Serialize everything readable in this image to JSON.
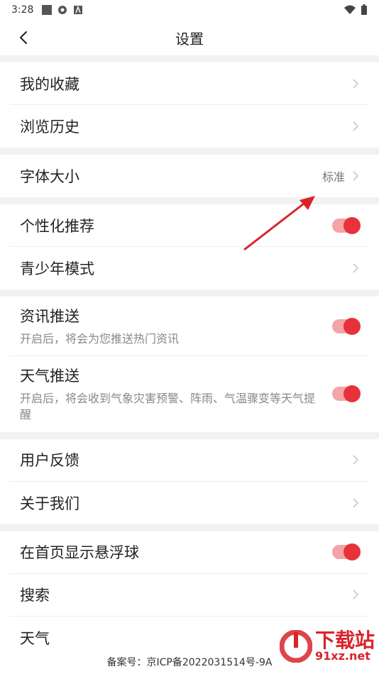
{
  "status": {
    "time": "3:28"
  },
  "header": {
    "title": "设置"
  },
  "groups": [
    [
      {
        "label": "我的收藏",
        "kind": "chevron"
      },
      {
        "label": "浏览历史",
        "kind": "chevron"
      }
    ],
    [
      {
        "label": "字体大小",
        "kind": "chevron",
        "value": "标准"
      }
    ],
    [
      {
        "label": "个性化推荐",
        "kind": "toggle",
        "on": true
      },
      {
        "label": "青少年模式",
        "kind": "chevron"
      }
    ],
    [
      {
        "label": "资讯推送",
        "kind": "toggle",
        "on": true,
        "sub": "开启后，将会为您推送热门资讯"
      },
      {
        "label": "天气推送",
        "kind": "toggle",
        "on": true,
        "sub": "开启后，将会收到气象灾害预警、阵雨、气温骤变等天气提醒"
      }
    ],
    [
      {
        "label": "用户反馈",
        "kind": "chevron"
      },
      {
        "label": "关于我们",
        "kind": "chevron"
      }
    ],
    [
      {
        "label": "在首页显示悬浮球",
        "kind": "toggle",
        "on": true
      },
      {
        "label": "搜索",
        "kind": "chevron"
      },
      {
        "label": "天气",
        "kind": "chevron"
      }
    ]
  ],
  "footer": {
    "text": "备案号：京ICP备2022031514号-9A"
  },
  "watermark": {
    "title": "下载站",
    "sub": "91xz.net"
  },
  "colors": {
    "accent": "#e8323a",
    "toggle_track": "#f4a3a6"
  }
}
